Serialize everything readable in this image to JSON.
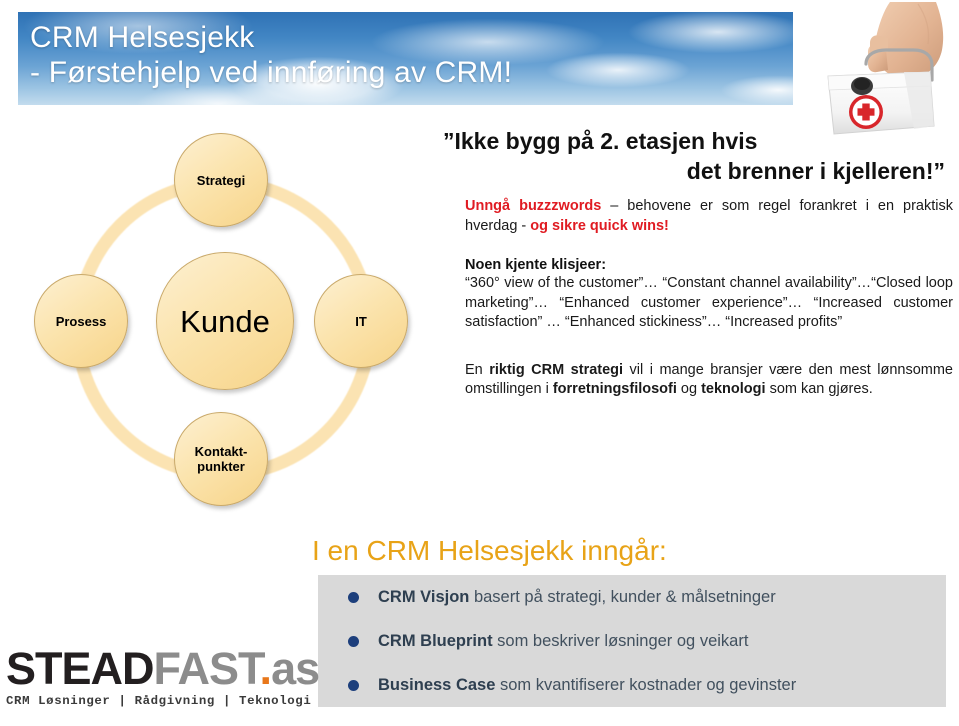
{
  "header": {
    "title": "CRM Helsesjekk\n- Førstehjelp ved innføring av CRM!",
    "banner_image": "sky-clouds-image",
    "side_image": "first-aid-kit-image"
  },
  "diagram": {
    "name": "crm-circle-diagram",
    "center": {
      "label": "Kunde"
    },
    "nodes": [
      {
        "id": "strategi",
        "label": "Strategi",
        "position": "top"
      },
      {
        "id": "prosess",
        "label": "Prosess",
        "position": "left"
      },
      {
        "id": "it",
        "label": "IT",
        "position": "right"
      },
      {
        "id": "kontaktpunkter",
        "label": "Kontakt-\npunkter",
        "position": "bottom"
      }
    ],
    "ring_color": "#fbe3b2",
    "node_color": "#f7d489"
  },
  "content": {
    "quote_line1": "”Ikke bygg på 2. etasjen hvis",
    "quote_line2": "det brenner i kjelleren!”",
    "buzzwords": {
      "lead": "Unngå buzzzwords",
      "middle": " – behovene er som regel forankret i en praktisk hverdag  - ",
      "tail": "og sikre quick wins!"
    },
    "klisjeer": {
      "heading": "Noen kjente klisjeer:",
      "body": "“360° view of the customer”… “Constant channel availability”…“Closed loop marketing”… “Enhanced customer experience”… “Increased customer satisfaction” … “Enhanced stickiness”… “Increased profits”"
    },
    "strategi_para": {
      "p1": "En ",
      "b1": "riktig CRM strategi",
      "p2": " vil i mange bransjer være den mest lønnsomme omstillingen i ",
      "b2": "forretningsfilosofi",
      "p3": " og ",
      "b3": "teknologi",
      "p4": " som kan gjøres."
    }
  },
  "bottom": {
    "heading": "I en CRM Helsesjekk inngår:",
    "heading_color": "#e8a317",
    "panel_color": "#d9d9d9",
    "bullet_color": "#1d3f7c",
    "bullets": [
      {
        "bold": "CRM Visjon",
        "rest": " basert på strategi, kunder & målsetninger"
      },
      {
        "bold": "CRM Blueprint",
        "rest": " som beskriver løsninger og veikart"
      },
      {
        "bold": "Business Case",
        "rest": " som kvantifiserer kostnader og gevinster"
      }
    ]
  },
  "logo": {
    "part1": "STEAD",
    "part2": "FAST",
    "part3": ".",
    "part4": "as",
    "tagline": "CRM Løsninger | Rådgivning | Teknologi"
  }
}
